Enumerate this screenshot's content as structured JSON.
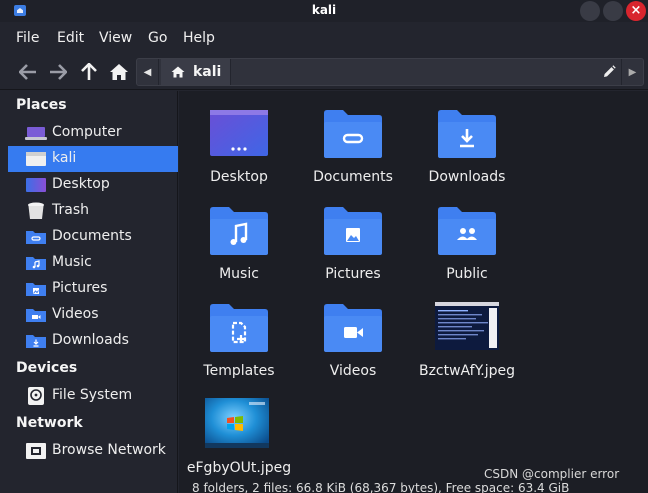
{
  "window": {
    "title": "kali",
    "close_glyph": "×"
  },
  "menu": [
    "File",
    "Edit",
    "View",
    "Go",
    "Help"
  ],
  "toolbar": {
    "icons": [
      "back-arrow-icon",
      "forward-arrow-icon",
      "up-arrow-icon",
      "home-icon"
    ],
    "path": {
      "crumb": "kali",
      "icons": [
        "chevron-left-icon",
        "home-icon",
        "pencil-icon",
        "chevron-right-icon"
      ]
    }
  },
  "sidebar": {
    "places_title": "Places",
    "places": [
      {
        "label": "Computer",
        "icon": "computer-icon"
      },
      {
        "label": "kali",
        "icon": "home-folder-icon",
        "active": true
      },
      {
        "label": "Desktop",
        "icon": "desktop-icon"
      },
      {
        "label": "Trash",
        "icon": "trash-icon"
      },
      {
        "label": "Documents",
        "icon": "documents-folder-icon"
      },
      {
        "label": "Music",
        "icon": "music-folder-icon"
      },
      {
        "label": "Pictures",
        "icon": "pictures-folder-icon"
      },
      {
        "label": "Videos",
        "icon": "videos-folder-icon"
      },
      {
        "label": "Downloads",
        "icon": "downloads-folder-icon"
      }
    ],
    "devices_title": "Devices",
    "devices": [
      {
        "label": "File System",
        "icon": "drive-icon"
      }
    ],
    "network_title": "Network",
    "network": [
      {
        "label": "Browse Network",
        "icon": "network-icon"
      }
    ]
  },
  "files": [
    {
      "name": "Desktop",
      "icon": "desktop-folder-icon"
    },
    {
      "name": "Documents",
      "icon": "documents-folder-icon"
    },
    {
      "name": "Downloads",
      "icon": "downloads-folder-icon"
    },
    {
      "name": "Music",
      "icon": "music-folder-icon"
    },
    {
      "name": "Pictures",
      "icon": "pictures-folder-icon"
    },
    {
      "name": "Public",
      "icon": "public-folder-icon"
    },
    {
      "name": "Templates",
      "icon": "templates-folder-icon"
    },
    {
      "name": "Videos",
      "icon": "videos-folder-icon"
    },
    {
      "name": "BzctwAfY.jpeg",
      "icon": "terminal-screenshot-thumbnail"
    },
    {
      "name": "eFgbyOUt.jpeg",
      "icon": "windows-desktop-thumbnail"
    }
  ],
  "status": "8 folders, 2 files: 66.8 KiB (68,367 bytes), Free space: 63.4 GiB",
  "watermark": "CSDN @complier error",
  "colors": {
    "accent": "#367bf0",
    "folder": "#3f7ff0",
    "close": "#d8252e"
  }
}
